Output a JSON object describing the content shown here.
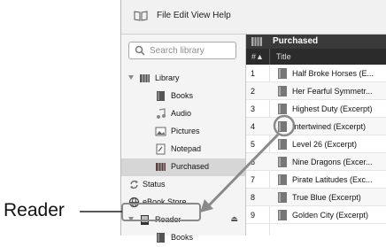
{
  "menubar": {
    "items_text": "File  Edit  View  Help"
  },
  "search": {
    "placeholder": "Search library"
  },
  "sidebar": {
    "items": [
      {
        "label": "Library",
        "icon": "library-icon"
      },
      {
        "label": "Books",
        "icon": "books-icon"
      },
      {
        "label": "Audio",
        "icon": "audio-icon"
      },
      {
        "label": "Pictures",
        "icon": "pictures-icon"
      },
      {
        "label": "Notepad",
        "icon": "notepad-icon"
      },
      {
        "label": "Purchased",
        "icon": "purchased-icon"
      },
      {
        "label": "Status",
        "icon": "status-icon"
      },
      {
        "label": "eBook Store",
        "icon": "globe-icon"
      },
      {
        "label": "Reader",
        "icon": "reader-device-icon"
      },
      {
        "label": "Books",
        "icon": "books-icon"
      }
    ]
  },
  "main": {
    "header_title": "Purchased",
    "columns": {
      "num": "#▲",
      "title": "Title"
    },
    "rows": [
      {
        "num": "1",
        "title": "Half Broke Horses (E..."
      },
      {
        "num": "2",
        "title": "Her Fearful Symmetr..."
      },
      {
        "num": "3",
        "title": "Highest Duty (Excerpt)"
      },
      {
        "num": "4",
        "title": "Intertwined (Excerpt)"
      },
      {
        "num": "5",
        "title": "Level 26 (Excerpt)"
      },
      {
        "num": "6",
        "title": "Nine Dragons (Excer..."
      },
      {
        "num": "7",
        "title": "Pirate Latitudes (Exc..."
      },
      {
        "num": "8",
        "title": "True Blue (Excerpt)"
      },
      {
        "num": "9",
        "title": "Golden City (Excerpt)"
      }
    ]
  },
  "callout": {
    "label": "Reader"
  },
  "colors": {
    "header_bg": "#3a3a3a",
    "selected_bg": "#d6d6d6",
    "arrow": "#8a8a8a"
  }
}
